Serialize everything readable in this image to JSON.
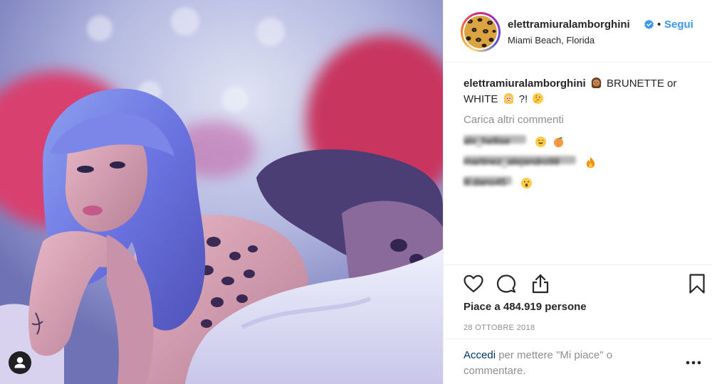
{
  "post": {
    "username": "elettramiuralamborghini",
    "follow_separator": "•",
    "follow_label": "Segui",
    "location": "Miami Beach, Florida"
  },
  "caption": {
    "username": "elettramiuralamborghini",
    "text_part1": "BRUNETTE or",
    "text_part2": "WHITE",
    "text_part3": "?!"
  },
  "comments": {
    "load_more": "Carica altri commenti",
    "items": [
      {
        "username": "alx_hellise",
        "emojis": [
          "grinning-face",
          "peach"
        ]
      },
      {
        "username": "martinez_alejandro98",
        "emojis": [
          "fire"
        ]
      },
      {
        "username": "lil.dano45",
        "emojis": [
          "astonished-face"
        ]
      }
    ]
  },
  "actions": {
    "icons": [
      "heart-icon",
      "comment-icon",
      "share-icon",
      "bookmark-icon"
    ],
    "likes": "Piace a 484.919 persone",
    "date": "28 OTTOBRE 2018"
  },
  "login": {
    "link": "Accedi",
    "text": "per mettere \"Mi piace\" o commentare."
  },
  "colors": {
    "link_blue": "#3897f0",
    "dark_link": "#003569",
    "muted": "#8e8e8e",
    "text": "#262626",
    "verified_blue": "#3897f0"
  }
}
